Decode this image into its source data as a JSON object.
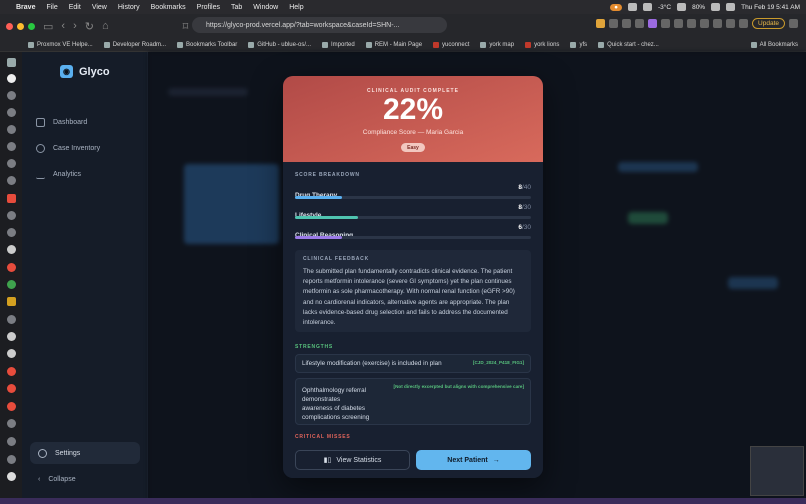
{
  "menubar": {
    "app": "Brave",
    "items": [
      "File",
      "Edit",
      "View",
      "History",
      "Bookmarks",
      "Profiles",
      "Tab",
      "Window",
      "Help"
    ],
    "weather": "-3°C",
    "battery": "80%",
    "clock": "Thu Feb 19  5:41 AM"
  },
  "browser": {
    "url": "https://glyco-prod.vercel.app/?tab=workspace&caseId=SHN-...",
    "update_label": "Update",
    "bookmarks": [
      "Proxmox VE Helpe...",
      "Developer Roadm...",
      "Bookmarks Toolbar",
      "GitHub - ublue-os/...",
      "Imported",
      "REM - Main Page",
      "yuconnect",
      "york map",
      "york lions",
      "yfs",
      "Quick start - chez..."
    ],
    "all_bookmarks": "All Bookmarks"
  },
  "sidebar": {
    "brand": "Glyco",
    "nav": [
      "Dashboard",
      "Case Inventory",
      "Analytics"
    ],
    "settings": "Settings",
    "collapse": "Collapse"
  },
  "modal": {
    "kicker": "CLINICAL AUDIT COMPLETE",
    "score": "22%",
    "subtitle": "Compliance Score — Maria Garcia",
    "difficulty": "Easy",
    "breakdown_title": "SCORE BREAKDOWN",
    "breakdown": [
      {
        "label": "Drug Therapy",
        "score": 8,
        "max": 40,
        "color": "#5ab0f0"
      },
      {
        "label": "Lifestyle",
        "score": 8,
        "max": 30,
        "color": "#4fc4b0"
      },
      {
        "label": "Clinical Reasoning",
        "score": 6,
        "max": 30,
        "color": "#9b7be8"
      }
    ],
    "feedback_title": "CLINICAL FEEDBACK",
    "feedback": "The submitted plan fundamentally contradicts clinical evidence. The patient reports metformin intolerance (severe GI symptoms) yet the plan continues metformin as sole pharmacotherapy. With normal renal function (eGFR >90) and no cardiorenal indicators, alternative agents are appropriate. The plan lacks evidence-based drug selection and fails to address the documented intolerance.",
    "strengths_title": "STRENGTHS",
    "strengths": [
      {
        "text": "Lifestyle modification (exercise) is included in plan",
        "tag": "[CJD_2024_P418_FIG1]"
      },
      {
        "text": "Ophthalmology referral demonstrates awareness of diabetes complications screening",
        "tag": "[Not directly excerpted but aligns with comprehensive care]"
      }
    ],
    "critical_title": "CRITICAL MISSES",
    "view_stats": "View Statistics",
    "next_patient": "Next Patient"
  }
}
